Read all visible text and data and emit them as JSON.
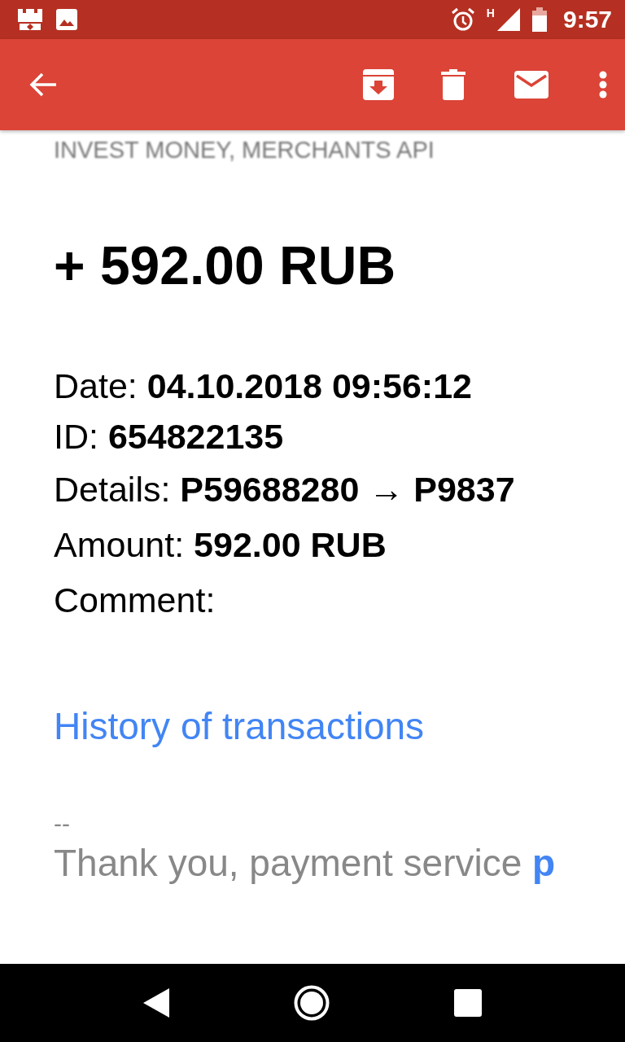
{
  "status_bar": {
    "time": "9:57",
    "network": "H"
  },
  "email": {
    "sender_heading": "INVEST MONEY, MERCHANTS API",
    "amount_heading": "+ 592.00 RUB",
    "details": [
      {
        "label": "Date: ",
        "value": "04.10.2018 09:56:12"
      },
      {
        "label": "ID: ",
        "value": "654822135"
      },
      {
        "label": "Details: ",
        "value": "P59688280 → P9837"
      },
      {
        "label": "Amount: ",
        "value": "592.00 RUB"
      },
      {
        "label": "Comment:"
      }
    ],
    "history_link": "History of transactions",
    "signature_separator": "--",
    "thanks": {
      "text": "Thank you, payment service ",
      "link": "p"
    }
  }
}
